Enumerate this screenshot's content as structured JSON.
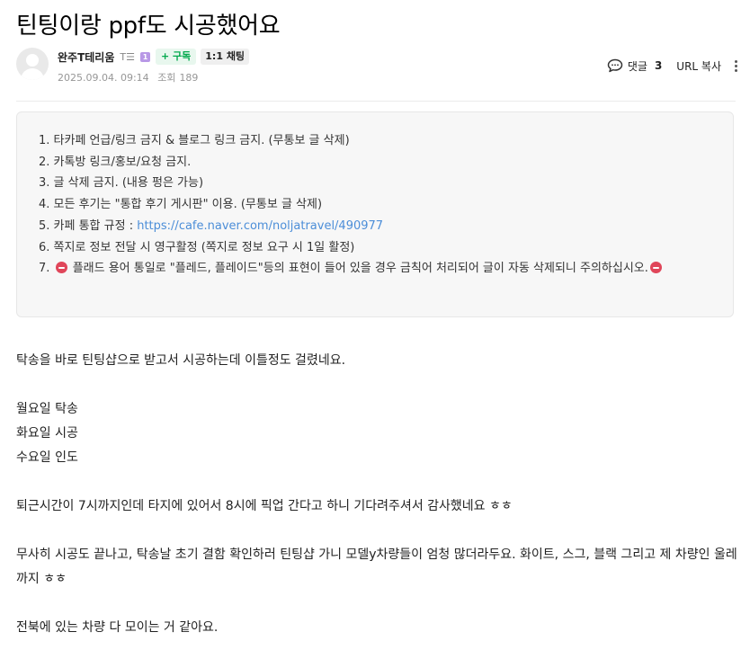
{
  "post": {
    "title": "틴팅이랑 ppf도 시공했어요",
    "author": {
      "name": "완주T테리움",
      "level_text": "T☰",
      "level_badge": "1",
      "subscribe_label": "+ 구독",
      "chat_label": "1:1 채팅"
    },
    "date": "2025.09.04. 09:14",
    "views_label": "조회",
    "views": "189",
    "tools": {
      "comment_label": "댓글",
      "comment_count": "3",
      "url_copy_label": "URL 복사"
    }
  },
  "notice": {
    "items": [
      "1. 타카페 언급/링크 금지 & 블로그 링크 금지. (무통보 글 삭제)",
      "2. 카톡방 링크/홍보/요청 금지.",
      "3. 글 삭제 금지. (내용 펑은 가능)",
      "4. 모든 후기는 \"통합 후기 게시판\" 이용. (무통보 글 삭제)",
      "5. 카페 통합 규정 : ",
      "6. 쪽지로 정보 전달 시 영구활정 (쪽지로 정보 요구 시 1일 활정)",
      "7. ",
      "플래드 용어 통일로 \"플레드, 플레이드\"등의 표현이 들어 있을 경우 금칙어 처리되어 글이 자동 삭제되니 주의하십시오."
    ],
    "rule_link": "https://cafe.naver.com/noljatravel/490977",
    "stop_icon_color": "#e0465a",
    "link_color": "#4c8ed8"
  },
  "body": {
    "paragraphs": [
      "탁송을 바로 틴팅샵으로 받고서 시공하는데 이틀정도 걸렸네요.",
      "월요일 탁송",
      "화요일 시공",
      "수요일 인도",
      "퇴근시간이 7시까지인데 타지에 있어서 8시에 픽업 간다고 하니 기다려주셔서 감사했네요 ㅎㅎ",
      "무사히 시공도 끝나고, 탁송날 초기 결함 확인하러 틴팅샵 가니 모델y차량들이 엄청 많더라두요. 화이트, 스그, 블랙 그리고 제 차량인 울레까지 ㅎㅎ",
      "전북에 있는 차량 다 모이는 거 같아요."
    ]
  },
  "colors": {
    "subscribe_green": "#03a94d",
    "notice_bg": "#f7f7f7"
  },
  "icons": {
    "avatar": "default-user-avatar",
    "comment": "speech-bubble-icon",
    "more": "vertical-dots-icon",
    "stop": "no-entry-icon"
  }
}
